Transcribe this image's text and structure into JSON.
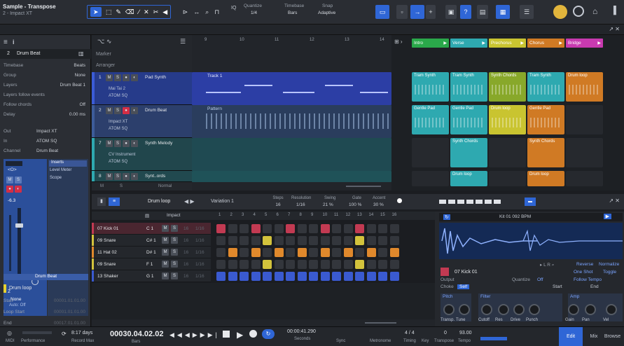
{
  "app": {
    "title": "Sample - Transpose",
    "subtitle": "2 - Impact XT"
  },
  "toolbar": {
    "quantize_label": "Quantize",
    "quantize_value": "1/4",
    "timebase_label": "Timebase",
    "timebase_value": "Bars",
    "snap_label": "Snap",
    "snap_value": "Adaptive",
    "iq": "IQ"
  },
  "inspector": {
    "track_num": "2",
    "track_name": "Drum Beat",
    "rows": [
      [
        "Timebase",
        "Beats"
      ],
      [
        "Group",
        "None"
      ],
      [
        "Layers",
        "Drum Beat 1"
      ],
      [
        "Layers follow events",
        ""
      ],
      [
        "Follow chords",
        "Off"
      ],
      [
        "Delay",
        "0.00 ms"
      ]
    ],
    "io": [
      [
        "Out",
        "Impact XT"
      ],
      [
        "In",
        "ATOM SQ"
      ],
      [
        "Channel",
        "Drum Beat"
      ]
    ],
    "inserts": "Inserts",
    "level_meter": "Level Meter",
    "scope": "Scope",
    "io_label": "<O>",
    "vol": "-6.3",
    "ch_num": "2",
    "none": "None",
    "auto": "Auto: Off",
    "ch_name": "Drum Beat",
    "event_name": "Drum loop",
    "start_label": "Start",
    "start_val": "00001.01.01.00",
    "loopstart_label": "Loop Start",
    "loopstart_val": "00001.01.01.00",
    "end_label": "End",
    "end_val": "00017.01.01.00"
  },
  "header": {
    "marker": "Marker",
    "arranger": "Arranger",
    "ruler": [
      "9",
      "10",
      "11",
      "12",
      "13",
      "14",
      "15"
    ]
  },
  "tracks": [
    {
      "num": "1",
      "name": "Pad Synth",
      "in1": "Mai Tai 2",
      "in2": "ATOM SQ",
      "clip": "Track 1"
    },
    {
      "num": "2",
      "name": "Drum Beat",
      "in1": "Impact XT",
      "in2": "ATOM SQ",
      "clip": "Pattern"
    },
    {
      "num": "7",
      "name": "Synth Melody",
      "in1": "CV Instrument",
      "in2": "ATOM SQ",
      "clip": ""
    },
    {
      "num": "8",
      "name": "Synt..ords",
      "in1": "",
      "in2": "",
      "clip": ""
    }
  ],
  "track_footer": {
    "m": "M",
    "s": "S",
    "normal": "Normal"
  },
  "scenes": [
    "Intro",
    "Verse",
    "Prechorus",
    "Chorus",
    "Bridge"
  ],
  "launcher": [
    [
      {
        "t": "Tram Synth",
        "c": "#2ea9b0"
      },
      {
        "t": "Tram Synth",
        "c": "#2ea9b0"
      },
      {
        "t": "Synth Chords",
        "c": "#88a82a"
      },
      {
        "t": "Tram Synth",
        "c": "#2ea9b0"
      },
      {
        "t": "Drum loop",
        "c": "#d07a24"
      }
    ],
    [
      {
        "t": "Gentle Pad",
        "c": "#2ea9b0"
      },
      {
        "t": "Gentle Pad",
        "c": "#2ea9b0"
      },
      {
        "t": "Drum loop",
        "c": "#c9c430"
      },
      {
        "t": "Gentle Pad",
        "c": "#d07a24"
      },
      {
        "t": "",
        "c": ""
      }
    ],
    [
      {
        "t": "",
        "c": ""
      },
      {
        "t": "Synth Chords",
        "c": "#2ea9b0"
      },
      {
        "t": "",
        "c": ""
      },
      {
        "t": "Synth Chords",
        "c": "#d07a24"
      },
      {
        "t": "",
        "c": ""
      }
    ],
    [
      {
        "t": "",
        "c": ""
      },
      {
        "t": "Drum loop",
        "c": "#2ea9b0"
      },
      {
        "t": "",
        "c": ""
      },
      {
        "t": "Drum loop",
        "c": "#d07a24"
      },
      {
        "t": "",
        "c": ""
      }
    ]
  ],
  "editor": {
    "name": "Drum loop",
    "variation": "Variation 1",
    "steps_l": "Steps",
    "steps_v": "16",
    "res_l": "Resolution",
    "res_v": "1/16",
    "swing_l": "Swing",
    "swing_v": "21 %",
    "gate_l": "Gate",
    "gate_v": "100 %",
    "accent_l": "Accent",
    "accent_v": "30 %",
    "instrument": "Impact",
    "cols": [
      "1",
      "2",
      "3",
      "4",
      "5",
      "6",
      "7",
      "8",
      "9",
      "10",
      "11",
      "12",
      "13",
      "14",
      "15",
      "16"
    ]
  },
  "pattern_rows": [
    {
      "name": "07 Kick 01",
      "note": "C 1",
      "st": "16",
      "res": "1/16",
      "steps": [
        1,
        0,
        0,
        1,
        0,
        0,
        1,
        0,
        0,
        1,
        0,
        0,
        1,
        0,
        0,
        0
      ],
      "color": "#c23a52"
    },
    {
      "name": "09 Snare",
      "note": "C# 1",
      "st": "16",
      "res": "1/16",
      "steps": [
        0,
        0,
        0,
        0,
        1,
        0,
        0,
        0,
        0,
        0,
        0,
        0,
        1,
        0,
        0,
        0
      ],
      "color": "#d3c33c"
    },
    {
      "name": "11 Hat 02",
      "note": "D# 1",
      "st": "16",
      "res": "1/16",
      "steps": [
        0,
        1,
        0,
        1,
        0,
        1,
        0,
        1,
        0,
        1,
        0,
        1,
        0,
        1,
        0,
        1
      ],
      "color": "#e0892c"
    },
    {
      "name": "09 Snare",
      "note": "F 1",
      "st": "16",
      "res": "1/16",
      "steps": [
        0,
        0,
        0,
        0,
        1,
        0,
        0,
        0,
        0,
        0,
        0,
        0,
        1,
        0,
        0,
        0
      ],
      "color": "#d3c33c"
    },
    {
      "name": "13 Shaker",
      "note": "G 1",
      "st": "16",
      "res": "1/16",
      "steps": [
        1,
        1,
        1,
        1,
        1,
        1,
        1,
        1,
        1,
        1,
        1,
        1,
        1,
        1,
        1,
        1
      ],
      "color": "#3a5ad0"
    }
  ],
  "sampler": {
    "file": "Kit 01 092 BPM",
    "sample": "07 Kick 01",
    "output": "Output",
    "choke": "Choke",
    "self": "Self",
    "reverse": "Reverse",
    "normalize": "Normalize",
    "oneshot": "One Shot",
    "toggle": "Toggle",
    "quantize": "Quantize",
    "off": "Off",
    "follow": "Follow Tempo",
    "start": "Start",
    "end": "End",
    "pitch": "Pitch",
    "filter": "Filter",
    "amp": "Amp",
    "knobs": [
      "Transp.",
      "Tune",
      "Cutoff",
      "Res",
      "Drive",
      "Punch",
      "Gain",
      "Pan",
      "Vel"
    ]
  },
  "transport": {
    "midi": "MIDI",
    "perf": "Performance",
    "days": "8:17 days",
    "record_max": "Record Max",
    "time": "00030.04.02.02",
    "bars": "Bars",
    "seconds": "00:00:41.290",
    "sec_l": "Seconds",
    "sync": "Sync",
    "metronome": "Metronome",
    "timing": "Timing",
    "sig": "4 / 4",
    "key": "Key",
    "transpose": "Transpose",
    "tempo": "93.00",
    "tempo_l": "Tempo",
    "t0": "0",
    "edit": "Edit",
    "mix": "Mix",
    "browse": "Browse"
  },
  "colors": {
    "blue": "#2f66d6",
    "green": "#2aa84a",
    "cyan": "#2ea9b0",
    "orange": "#d07a24",
    "magenta": "#c83ab0"
  }
}
